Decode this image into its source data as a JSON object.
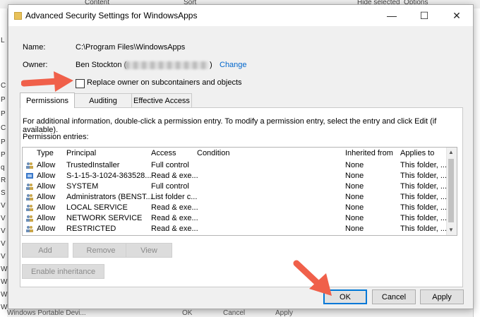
{
  "background": {
    "top_items": [
      "Content",
      "Sort",
      "Hide selected",
      "Options"
    ],
    "left_letters": [
      "L",
      "C",
      "P",
      "P",
      "C",
      "P",
      "P",
      "q",
      "R",
      "S",
      "V",
      "V",
      "V",
      "V",
      "V",
      "W",
      "W",
      "W",
      "W",
      "W",
      "W"
    ],
    "bottom_text": "Windows Portable Devi...",
    "bottom_buttons": [
      "OK",
      "Cancel",
      "Apply"
    ]
  },
  "dialog": {
    "title": "Advanced Security Settings for WindowsApps",
    "window_controls": {
      "minimize": "—",
      "maximize": "☐",
      "close": "✕"
    },
    "name_label": "Name:",
    "name_value": "C:\\Program Files\\WindowsApps",
    "owner_label": "Owner:",
    "owner_value": "Ben Stockton (",
    "owner_close": ")",
    "change_link": "Change",
    "replace_owner_label": "Replace owner on subcontainers and objects",
    "tabs": [
      {
        "label": "Permissions",
        "active": true
      },
      {
        "label": "Auditing",
        "active": false
      },
      {
        "label": "Effective Access",
        "active": false
      }
    ],
    "info_text": "For additional information, double-click a permission entry. To modify a permission entry, select the entry and click Edit (if available).",
    "permission_entries_label": "Permission entries:",
    "columns": [
      "Type",
      "Principal",
      "Access",
      "Condition",
      "Inherited from",
      "Applies to"
    ],
    "rows": [
      {
        "type": "Allow",
        "principal": "TrustedInstaller",
        "access": "Full control",
        "condition": "",
        "inherited": "None",
        "applies": "This folder, ..."
      },
      {
        "type": "Allow",
        "principal": "S-1-15-3-1024-363528...",
        "access": "Read & exe...",
        "condition": "",
        "inherited": "None",
        "applies": "This folder, ..."
      },
      {
        "type": "Allow",
        "principal": "SYSTEM",
        "access": "Full control",
        "condition": "",
        "inherited": "None",
        "applies": "This folder, ..."
      },
      {
        "type": "Allow",
        "principal": "Administrators (BENST...",
        "access": "List folder c...",
        "condition": "",
        "inherited": "None",
        "applies": "This folder, ..."
      },
      {
        "type": "Allow",
        "principal": "LOCAL SERVICE",
        "access": "Read & exe...",
        "condition": "",
        "inherited": "None",
        "applies": "This folder, ..."
      },
      {
        "type": "Allow",
        "principal": "NETWORK SERVICE",
        "access": "Read & exe...",
        "condition": "",
        "inherited": "None",
        "applies": "This folder, ..."
      },
      {
        "type": "Allow",
        "principal": "RESTRICTED",
        "access": "Read & exe...",
        "condition": "",
        "inherited": "None",
        "applies": "This folder, ..."
      }
    ],
    "list_buttons": {
      "add": "Add",
      "remove": "Remove",
      "view": "View"
    },
    "enable_inheritance": "Enable inheritance",
    "ok": "OK",
    "cancel": "Cancel",
    "apply": "Apply",
    "colors": {
      "link": "#0066cc",
      "accent": "#0078d7",
      "arrow": "#f0604a"
    }
  }
}
